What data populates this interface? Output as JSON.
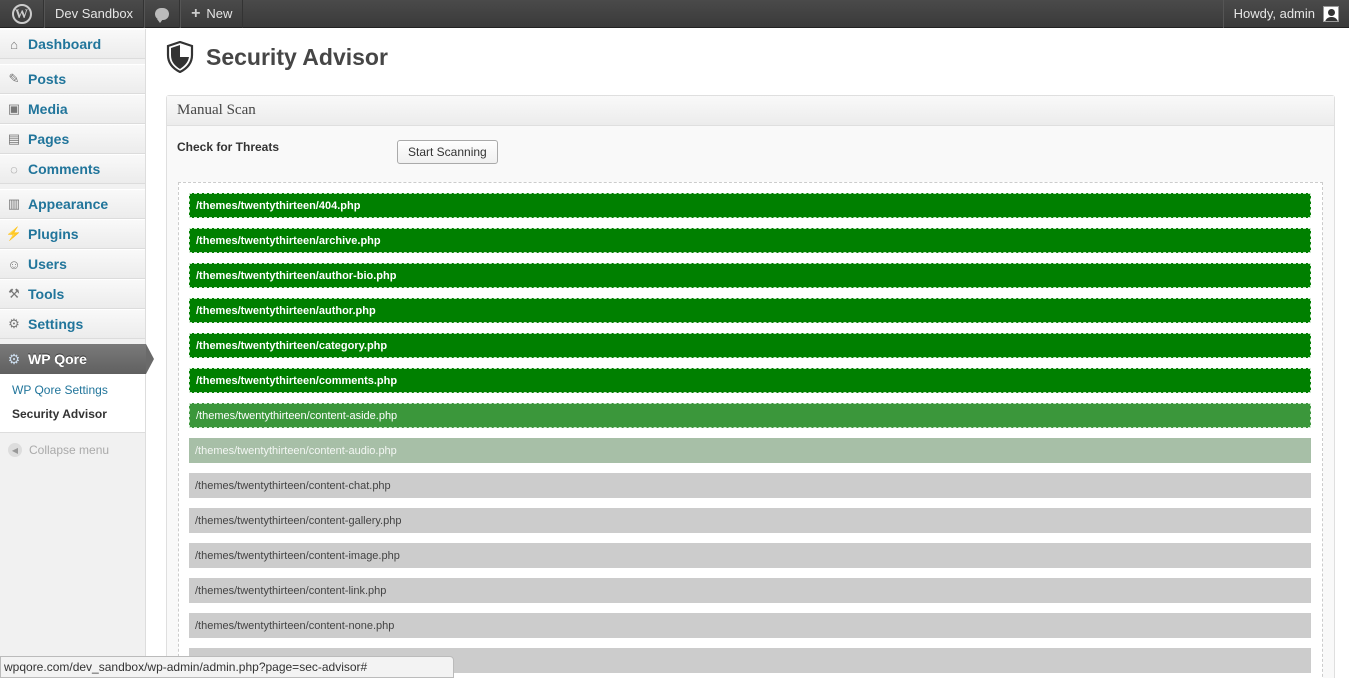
{
  "adminbar": {
    "site_name": "Dev Sandbox",
    "new_label": "New",
    "howdy": "Howdy, admin"
  },
  "sidebar": {
    "items": [
      {
        "label": "Dashboard",
        "icon": "dashboard-icon"
      },
      {
        "label": "Posts",
        "icon": "pin-icon"
      },
      {
        "label": "Media",
        "icon": "media-icon"
      },
      {
        "label": "Pages",
        "icon": "pages-icon"
      },
      {
        "label": "Comments",
        "icon": "comment-icon"
      },
      {
        "label": "Appearance",
        "icon": "appearance-icon"
      },
      {
        "label": "Plugins",
        "icon": "plug-icon"
      },
      {
        "label": "Users",
        "icon": "users-icon"
      },
      {
        "label": "Tools",
        "icon": "tools-icon"
      },
      {
        "label": "Settings",
        "icon": "settings-icon"
      }
    ],
    "active": {
      "label": "WP Qore",
      "icon": "gear-icon"
    },
    "submenu": [
      "WP Qore Settings",
      "Security Advisor"
    ],
    "collapse": "Collapse menu"
  },
  "main": {
    "title": "Security Advisor",
    "box_title": "Manual Scan",
    "check_label": "Check for Threats",
    "scan_button": "Start Scanning",
    "files": [
      {
        "path": "/themes/twentythirteen/404.php",
        "state": "done"
      },
      {
        "path": "/themes/twentythirteen/archive.php",
        "state": "done"
      },
      {
        "path": "/themes/twentythirteen/author-bio.php",
        "state": "done"
      },
      {
        "path": "/themes/twentythirteen/author.php",
        "state": "done"
      },
      {
        "path": "/themes/twentythirteen/category.php",
        "state": "done"
      },
      {
        "path": "/themes/twentythirteen/comments.php",
        "state": "done"
      },
      {
        "path": "/themes/twentythirteen/content-aside.php",
        "state": "fade1"
      },
      {
        "path": "/themes/twentythirteen/content-audio.php",
        "state": "fade2"
      },
      {
        "path": "/themes/twentythirteen/content-chat.php",
        "state": "pending"
      },
      {
        "path": "/themes/twentythirteen/content-gallery.php",
        "state": "pending"
      },
      {
        "path": "/themes/twentythirteen/content-image.php",
        "state": "pending"
      },
      {
        "path": "/themes/twentythirteen/content-link.php",
        "state": "pending"
      },
      {
        "path": "/themes/twentythirteen/content-none.php",
        "state": "pending"
      },
      {
        "path": "",
        "state": "pending"
      }
    ]
  },
  "statusbar": {
    "url": "wpqore.com/dev_sandbox/wp-admin/admin.php?page=sec-advisor#"
  },
  "colors": {
    "done": "#008000",
    "fade1": "#3b973b",
    "fade2": "#a7bfa7",
    "pending": "#cccccc"
  }
}
